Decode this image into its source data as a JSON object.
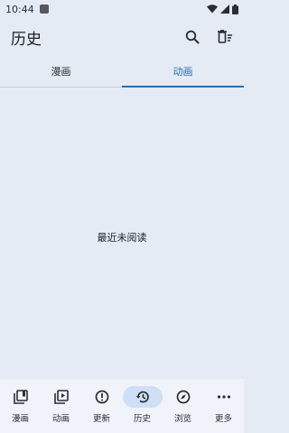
{
  "status": {
    "time": "10:44"
  },
  "app_bar": {
    "title": "历史"
  },
  "tabs": [
    {
      "label": "漫画",
      "active": false
    },
    {
      "label": "动画",
      "active": true
    }
  ],
  "empty_state": {
    "message": "最近未阅读"
  },
  "bottom_nav": [
    {
      "label": "漫画",
      "icon": "library-icon",
      "active": false
    },
    {
      "label": "动画",
      "icon": "video-library-icon",
      "active": false
    },
    {
      "label": "更新",
      "icon": "updates-icon",
      "active": false
    },
    {
      "label": "历史",
      "icon": "history-icon",
      "active": true
    },
    {
      "label": "浏览",
      "icon": "compass-icon",
      "active": false
    },
    {
      "label": "更多",
      "icon": "more-icon",
      "active": false
    }
  ],
  "colors": {
    "accent": "#2b6cb0",
    "background": "#e4ebf5",
    "nav_background": "#f0f4fa",
    "active_pill": "#cfe0f6"
  }
}
